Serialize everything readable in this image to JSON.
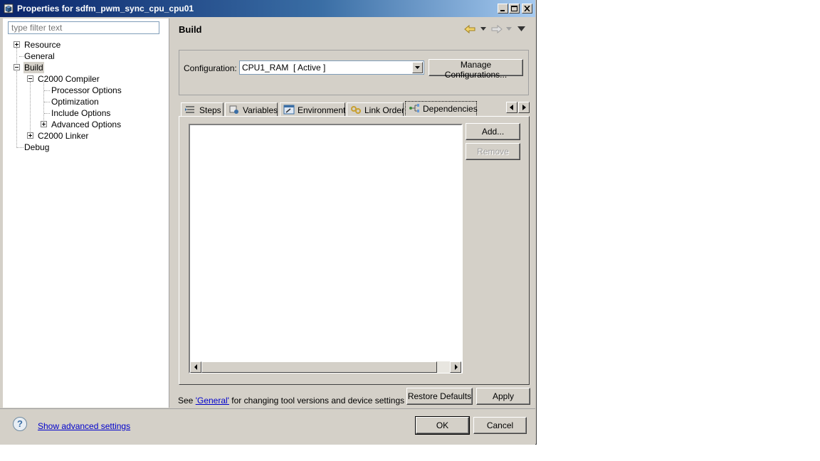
{
  "window": {
    "title": "Properties for sdfm_pwm_sync_cpu_cpu01",
    "caption_buttons": [
      "minimize-icon",
      "maximize-icon",
      "close-icon"
    ]
  },
  "filter": {
    "placeholder": "type filter text"
  },
  "tree": {
    "resource": "Resource",
    "general": "General",
    "build": "Build",
    "c2000_compiler": "C2000 Compiler",
    "processor_options": "Processor Options",
    "optimization": "Optimization",
    "include_options": "Include Options",
    "advanced_options": "Advanced Options",
    "c2000_linker": "C2000 Linker",
    "debug": "Debug"
  },
  "page": {
    "title": "Build"
  },
  "config": {
    "label": "Configuration:",
    "value": "CPU1_RAM  [ Active ]",
    "manage_button": "Manage Configurations..."
  },
  "tabs": [
    {
      "label": "Steps",
      "icon": "steps-icon"
    },
    {
      "label": "Variables",
      "icon": "variables-icon"
    },
    {
      "label": "Environment",
      "icon": "environment-icon"
    },
    {
      "label": "Link Order",
      "icon": "link-order-icon"
    },
    {
      "label": "Dependencies",
      "icon": "dependencies-icon",
      "active": true
    }
  ],
  "dependencies": {
    "add_button": "Add...",
    "remove_button": "Remove",
    "items": []
  },
  "footer": {
    "see_prefix": "See ",
    "see_link": "'General'",
    "see_suffix": " for changing tool versions and device settings",
    "restore_defaults": "Restore Defaults",
    "apply": "Apply"
  },
  "bottom": {
    "help_glyph": "?",
    "advanced_link": "Show advanced settings",
    "ok": "OK",
    "cancel": "Cancel"
  },
  "colors": {
    "titlebar_start": "#0a246a",
    "titlebar_end": "#a6caf0",
    "dialog_bg": "#d4d0c8",
    "link": "#0000cc"
  }
}
